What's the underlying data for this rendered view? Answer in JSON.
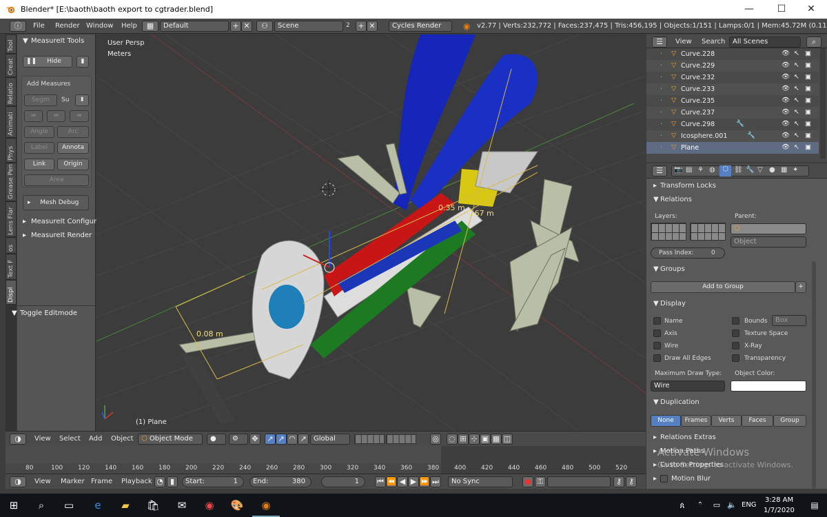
{
  "window": {
    "title": "Blender* [E:\\baoth\\baoth export to cgtrader.blend]",
    "minimize": "—",
    "maximize": "☐",
    "close": "✕"
  },
  "info": {
    "menus": [
      "File",
      "Render",
      "Window",
      "Help"
    ],
    "layout": "Default",
    "scene": "Scene",
    "scene_users": "2",
    "engine": "Cycles Render",
    "stats": "v2.77 | Verts:232,772 | Faces:237,475 | Tris:456,195 | Objects:1/151 | Lamps:0/1 | Mem:45.72M (0.11M) | Plane"
  },
  "left_tabs": [
    "Tool",
    "Creat",
    "Relatio",
    "Animati",
    "Phys",
    "Grease Pen",
    "Lens Flar",
    "os",
    "Text F",
    "Displ"
  ],
  "toolshelf": {
    "title": "MeasureIt Tools",
    "hide": "Hide",
    "add_measures": "Add Measures",
    "segm": "Segm",
    "su": "Su",
    "angle": "Angle",
    "arc": "Arc",
    "label": "Label",
    "annota": "Annota",
    "link": "Link",
    "origin": "Origin",
    "area": "Area",
    "mesh_debug": "Mesh Debug",
    "config": "MeasureIt Configura",
    "render": "MeasureIt Render",
    "toggle_edit": "Toggle Editmode"
  },
  "viewport": {
    "persp": "User Persp",
    "units": "Meters",
    "object_label": "(1) Plane",
    "measure1": "0.35 m",
    "measure2": "0.67 m",
    "measure3": "0.08 m"
  },
  "outliner": {
    "view": "View",
    "search": "Search",
    "scenes": "All Scenes",
    "rows": [
      "Curve.228",
      "Curve.229",
      "Curve.232",
      "Curve.233",
      "Curve.235",
      "Curve.237",
      "Curve.298",
      "Icosphere.001",
      "Plane"
    ]
  },
  "props": {
    "transform_locks": "Transform Locks",
    "relations": "Relations",
    "layers": "Layers:",
    "parent": "Parent:",
    "object": "Object",
    "pass_index": "Pass Index:",
    "pass_value": "0",
    "groups": "Groups",
    "add_to_group": "Add to Group",
    "display": "Display",
    "name": "Name",
    "axis": "Axis",
    "wire": "Wire",
    "draw_all_edges": "Draw All Edges",
    "bounds": "Bounds",
    "bounds_type": "Box",
    "texture_space": "Texture Space",
    "xray": "X-Ray",
    "transparency": "Transparency",
    "max_draw_type": "Maximum Draw Type:",
    "object_color": "Object Color:",
    "draw_type_value": "Wire",
    "duplication": "Duplication",
    "dup_tabs": [
      "None",
      "Frames",
      "Verts",
      "Faces",
      "Group"
    ],
    "relations_extras": "Relations Extras",
    "motion_paths": "Motion Paths",
    "custom_properties": "Custom Properties",
    "motion_blur": "Motion Blur",
    "watermark1": "Activate Windows",
    "watermark2": "Go to Settings to activate Windows."
  },
  "view3d_header": {
    "view": "View",
    "select": "Select",
    "add": "Add",
    "object": "Object",
    "mode": "Object Mode",
    "orientation": "Global"
  },
  "timeline": {
    "ticks": [
      "80",
      "100",
      "120",
      "140",
      "160",
      "180",
      "200",
      "220",
      "240",
      "260",
      "280",
      "300",
      "320",
      "340",
      "360",
      "380",
      "400",
      "420",
      "440",
      "460",
      "480",
      "500",
      "520"
    ],
    "view": "View",
    "marker": "Marker",
    "frame": "Frame",
    "playback": "Playback",
    "start_label": "Start:",
    "start": "1",
    "end_label": "End:",
    "end": "380",
    "current": "1",
    "sync": "No Sync"
  },
  "taskbar": {
    "time": "3:28 AM",
    "date": "1/7/2020",
    "lang": "ENG"
  },
  "colors": {
    "accent": "#5680c2",
    "panel": "#595959",
    "viewport": "#3c3c3c"
  }
}
